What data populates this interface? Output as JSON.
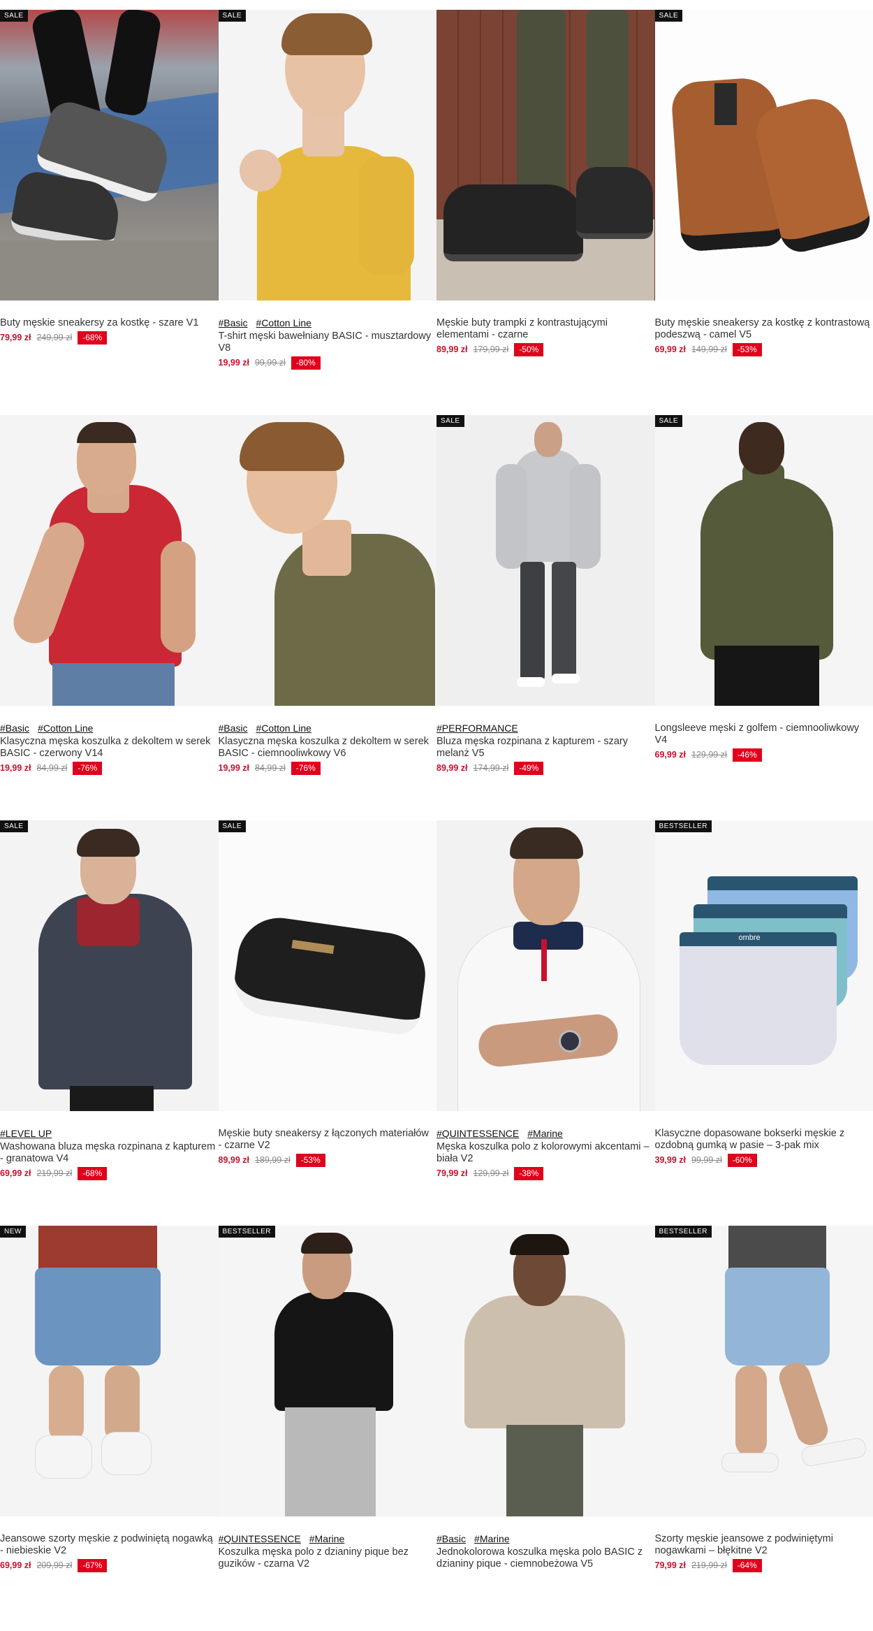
{
  "products": [
    {
      "badge": "SALE",
      "tags": [],
      "name": "Buty męskie sneakersy za kostkę - szare V1",
      "price": "79,99 zł",
      "old": "249,99 zł",
      "disc": "-68%"
    },
    {
      "badge": "SALE",
      "tags": [
        "#Basic",
        "#Cotton Line"
      ],
      "name": "T-shirt męski bawełniany BASIC - musztardowy V8",
      "price": "19,99 zł",
      "old": "99,99 zł",
      "disc": "-80%"
    },
    {
      "badge": "",
      "tags": [],
      "name": "Męskie buty trampki z kontrastującymi elementami - czarne",
      "price": "89,99 zł",
      "old": "179,99 zł",
      "disc": "-50%"
    },
    {
      "badge": "SALE",
      "tags": [],
      "name": "Buty męskie sneakersy za kostkę z kontrastową podeszwą - camel V5",
      "price": "69,99 zł",
      "old": "149,99 zł",
      "disc": "-53%"
    },
    {
      "badge": "",
      "tags": [
        "#Basic",
        "#Cotton Line"
      ],
      "name": "Klasyczna męska koszulka z dekoltem w serek BASIC - czerwony V14",
      "price": "19,99 zł",
      "old": "84,99 zł",
      "disc": "-76%"
    },
    {
      "badge": "",
      "tags": [
        "#Basic",
        "#Cotton Line"
      ],
      "name": "Klasyczna męska koszulka z dekoltem w serek BASIC - ciemnooliwkowy V6",
      "price": "19,99 zł",
      "old": "84,99 zł",
      "disc": "-76%"
    },
    {
      "badge": "SALE",
      "tags": [
        "#PERFORMANCE"
      ],
      "name": "Bluza męska rozpinana z kapturem - szary melanż V5",
      "price": "89,99 zł",
      "old": "174,99 zł",
      "disc": "-49%"
    },
    {
      "badge": "SALE",
      "tags": [],
      "name": "Longsleeve męski z golfem - ciemnooliwkowy V4",
      "price": "69,99 zł",
      "old": "129,99 zł",
      "disc": "-46%"
    },
    {
      "badge": "SALE",
      "tags": [
        "#LEVEL UP"
      ],
      "name": "Washowana bluza męska rozpinana z kapturem - granatowa V4",
      "price": "69,99 zł",
      "old": "219,99 zł",
      "disc": "-68%"
    },
    {
      "badge": "SALE",
      "tags": [],
      "name": "Męskie buty sneakersy z łączonych materiałów - czarne V2",
      "price": "89,99 zł",
      "old": "189,99 zł",
      "disc": "-53%"
    },
    {
      "badge": "",
      "tags": [
        "#QUINTESSENCE",
        "#Marine"
      ],
      "name": "Męska koszulka polo z kolorowymi akcentami – biała V2",
      "price": "79,99 zł",
      "old": "129,99 zł",
      "disc": "-38%"
    },
    {
      "badge": "BESTSELLER",
      "tags": [],
      "name": "Klasyczne dopasowane bokserki męskie z ozdobną gumką w pasie – 3-pak mix",
      "price": "39,99 zł",
      "old": "99,99 zł",
      "disc": "-60%"
    },
    {
      "badge": "NEW",
      "tags": [],
      "name": "Jeansowe szorty męskie z podwiniętą nogawką - niebieskie V2",
      "price": "69,99 zł",
      "old": "209,99 zł",
      "disc": "-67%"
    },
    {
      "badge": "BESTSELLER",
      "tags": [
        "#QUINTESSENCE",
        "#Marine"
      ],
      "name": "Koszulka męska polo z dzianiny pique bez guzików - czarna V2",
      "price": "",
      "old": "",
      "disc": ""
    },
    {
      "badge": "",
      "tags": [
        "#Basic",
        "#Marine"
      ],
      "name": "Jednokolorowa koszulka męska polo BASIC z dzianiny pique - ciemnobeżowa V5",
      "price": "",
      "old": "",
      "disc": ""
    },
    {
      "badge": "BESTSELLER",
      "tags": [],
      "name": "Szorty męskie jeansowe z podwiniętymi nogawkami – błękitne V2",
      "price": "79,99 zł",
      "old": "219,99 zł",
      "disc": "-64%"
    }
  ],
  "boxers_brand": "ombre",
  "colors": {
    "price": "#c8102e",
    "discount_bg": "#e0001b",
    "badge_bg": "#111111"
  }
}
